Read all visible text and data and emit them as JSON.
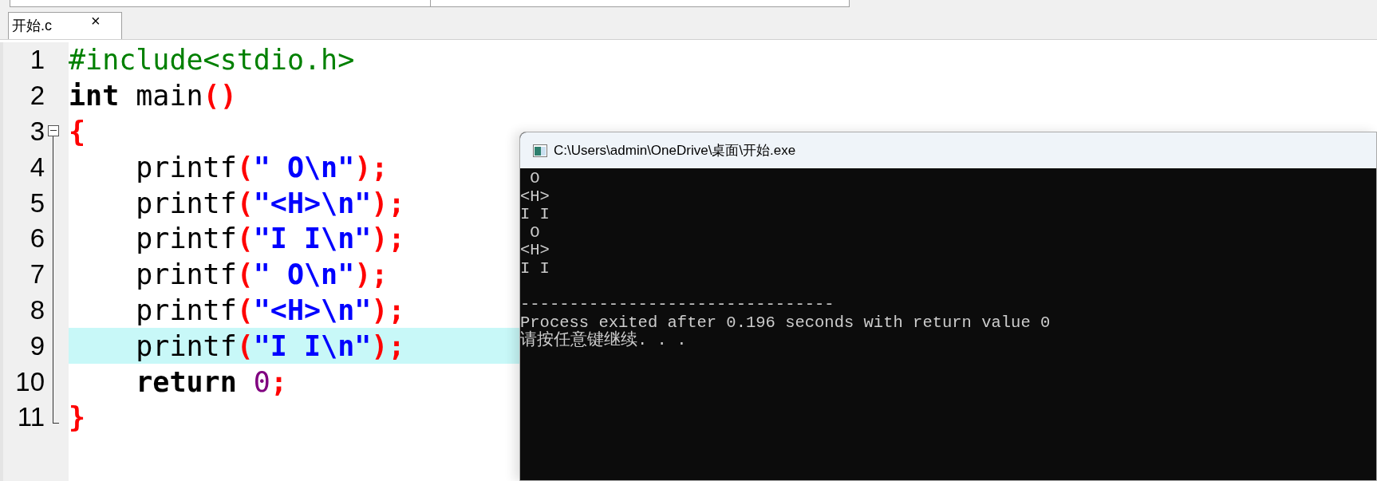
{
  "tabs": [
    {
      "label": "开始.c",
      "close": "×",
      "selected": true
    }
  ],
  "editor": {
    "lines": [
      {
        "number": "1",
        "highlighted": false,
        "kind": "plain",
        "tokens": [
          {
            "kind": "preprocessor",
            "text": "#include<stdio.h>"
          }
        ]
      },
      {
        "number": "2",
        "highlighted": false,
        "kind": "plain",
        "tokens": [
          {
            "kind": "keyword",
            "text": "int"
          },
          {
            "kind": "plain",
            "text": " main"
          },
          {
            "kind": "symbol",
            "text": "()"
          }
        ]
      },
      {
        "number": "3",
        "highlighted": false,
        "kind": "fold-start",
        "tokens": [
          {
            "kind": "symbol",
            "text": "{"
          }
        ]
      },
      {
        "number": "4",
        "highlighted": false,
        "kind": "fold-body",
        "tokens": [
          {
            "kind": "plain",
            "text": "    printf"
          },
          {
            "kind": "symbol",
            "text": "("
          },
          {
            "kind": "string",
            "text": "\" O\\n\""
          },
          {
            "kind": "symbol",
            "text": ");"
          }
        ]
      },
      {
        "number": "5",
        "highlighted": false,
        "kind": "fold-body",
        "tokens": [
          {
            "kind": "plain",
            "text": "    printf"
          },
          {
            "kind": "symbol",
            "text": "("
          },
          {
            "kind": "string",
            "text": "\"<H>\\n\""
          },
          {
            "kind": "symbol",
            "text": ");"
          }
        ]
      },
      {
        "number": "6",
        "highlighted": false,
        "kind": "fold-body",
        "tokens": [
          {
            "kind": "plain",
            "text": "    printf"
          },
          {
            "kind": "symbol",
            "text": "("
          },
          {
            "kind": "string",
            "text": "\"I I\\n\""
          },
          {
            "kind": "symbol",
            "text": ");"
          }
        ]
      },
      {
        "number": "7",
        "highlighted": false,
        "kind": "fold-body",
        "tokens": [
          {
            "kind": "plain",
            "text": "    printf"
          },
          {
            "kind": "symbol",
            "text": "("
          },
          {
            "kind": "string",
            "text": "\" O\\n\""
          },
          {
            "kind": "symbol",
            "text": ");"
          }
        ]
      },
      {
        "number": "8",
        "highlighted": false,
        "kind": "fold-body",
        "tokens": [
          {
            "kind": "plain",
            "text": "    printf"
          },
          {
            "kind": "symbol",
            "text": "("
          },
          {
            "kind": "string",
            "text": "\"<H>\\n\""
          },
          {
            "kind": "symbol",
            "text": ");"
          }
        ]
      },
      {
        "number": "9",
        "highlighted": true,
        "kind": "fold-body",
        "tokens": [
          {
            "kind": "plain",
            "text": "    printf"
          },
          {
            "kind": "symbol",
            "text": "("
          },
          {
            "kind": "string",
            "text": "\"I I\\n\""
          },
          {
            "kind": "symbol",
            "text": ");"
          }
        ]
      },
      {
        "number": "10",
        "highlighted": false,
        "kind": "fold-body",
        "tokens": [
          {
            "kind": "keyword",
            "text": "    return"
          },
          {
            "kind": "number",
            "text": " 0"
          },
          {
            "kind": "symbol",
            "text": ";"
          }
        ]
      },
      {
        "number": "11",
        "highlighted": false,
        "kind": "fold-end",
        "tokens": [
          {
            "kind": "symbol",
            "text": "}"
          }
        ]
      }
    ]
  },
  "console": {
    "title": "C:\\Users\\admin\\OneDrive\\桌面\\开始.exe",
    "lines": [
      {
        "kind": "text",
        "text": " O"
      },
      {
        "kind": "text",
        "text": "<H>"
      },
      {
        "kind": "text",
        "text": "I I"
      },
      {
        "kind": "text",
        "text": " O"
      },
      {
        "kind": "text",
        "text": "<H>"
      },
      {
        "kind": "text",
        "text": "I I"
      },
      {
        "kind": "separator",
        "text": "--------------------------------"
      },
      {
        "kind": "text",
        "text": "Process exited after 0.196 seconds with return value 0"
      },
      {
        "kind": "text",
        "text": "请按任意键继续. . ."
      }
    ]
  }
}
